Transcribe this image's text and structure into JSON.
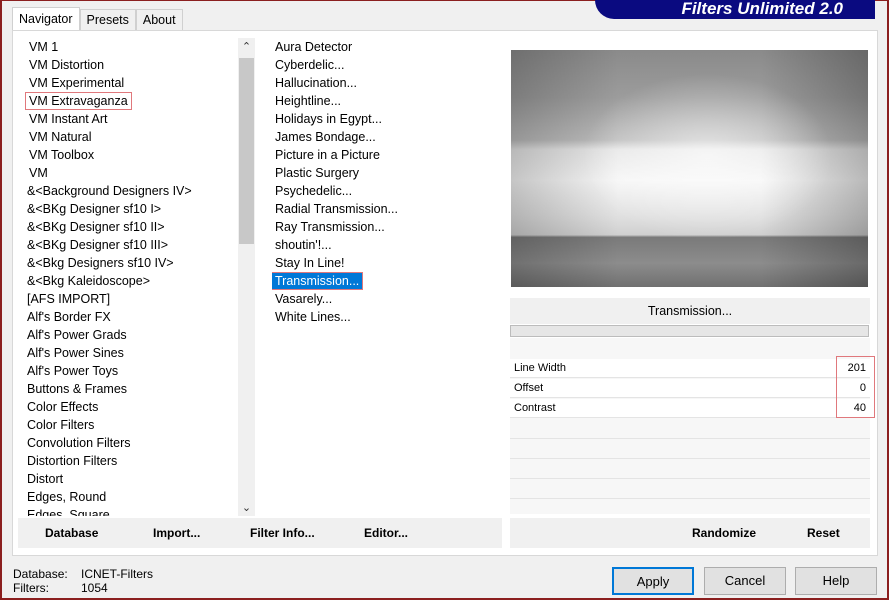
{
  "title": "Filters Unlimited 2.0",
  "tabs": [
    "Navigator",
    "Presets",
    "About"
  ],
  "categories": [
    "VM 1",
    "VM Distortion",
    "VM Experimental",
    "VM Extravaganza",
    "VM Instant Art",
    "VM Natural",
    "VM Toolbox",
    "VM",
    "&<Background Designers IV>",
    "&<BKg Designer sf10 I>",
    "&<BKg Designer sf10 II>",
    "&<BKg Designer sf10 III>",
    "&<Bkg Designers sf10 IV>",
    "&<Bkg Kaleidoscope>",
    "[AFS IMPORT]",
    "Alf's Border FX",
    "Alf's Power Grads",
    "Alf's Power Sines",
    "Alf's Power Toys",
    "Buttons & Frames",
    "Color Effects",
    "Color Filters",
    "Convolution Filters",
    "Distortion Filters",
    "Distort",
    "Edges, Round",
    "Edges, Square"
  ],
  "selected_category": "VM Extravaganza",
  "filters": [
    "Aura Detector",
    "Cyberdelic...",
    "Hallucination...",
    "Heightline...",
    "Holidays in Egypt...",
    "James Bondage...",
    "Picture in a Picture",
    "Plastic Surgery",
    "Psychedelic...",
    "Radial Transmission...",
    "Ray Transmission...",
    "shoutin'!...",
    "Stay In Line!",
    "Transmission...",
    "Vasarely...",
    "White Lines..."
  ],
  "selected_filter": "Transmission...",
  "filter_name": "Transmission...",
  "params": [
    {
      "label": "Line Width",
      "value": "201"
    },
    {
      "label": "Offset",
      "value": "0"
    },
    {
      "label": "Contrast",
      "value": "40"
    }
  ],
  "left_buttons": {
    "database": "Database",
    "import": "Import...",
    "filter_info": "Filter Info...",
    "editor": "Editor..."
  },
  "right_buttons": {
    "randomize": "Randomize",
    "reset": "Reset"
  },
  "status": {
    "database_label": "Database:",
    "database_value": "ICNET-Filters",
    "filters_label": "Filters:",
    "filters_value": "1054"
  },
  "dialog_buttons": {
    "apply": "Apply",
    "cancel": "Cancel",
    "help": "Help"
  },
  "colors": {
    "selection": "#0078d7",
    "banner": "#0a0a80",
    "highlight_box": "#e0787c"
  }
}
